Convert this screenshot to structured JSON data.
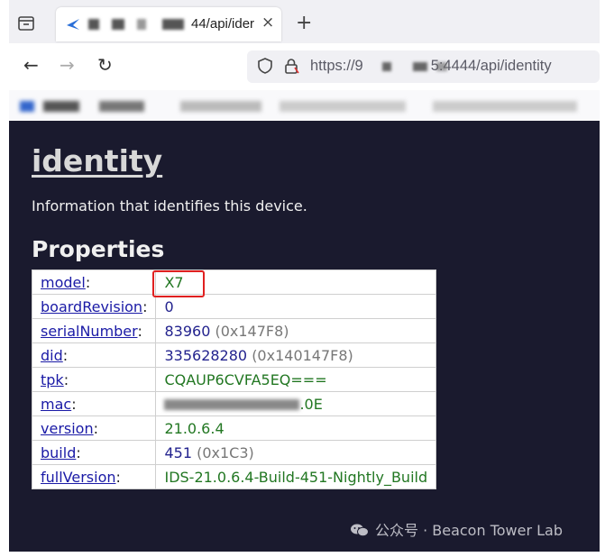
{
  "browser": {
    "tab": {
      "title_suffix": "44/api/ider",
      "close_icon": "×"
    },
    "new_tab_icon": "+",
    "nav": {
      "back_icon": "←",
      "forward_icon": "→",
      "reload_icon": "↻"
    },
    "url": {
      "prefix": "https://9",
      "suffix": "5:4444/api/identity"
    }
  },
  "page": {
    "title": "identity",
    "description": "Information that identifies this device.",
    "properties_heading": "Properties",
    "rows": [
      {
        "key": "model",
        "value": "X7",
        "extra": ""
      },
      {
        "key": "boardRevision",
        "value": "0",
        "extra": ""
      },
      {
        "key": "serialNumber",
        "value": "83960",
        "extra": "(0x147F8)"
      },
      {
        "key": "did",
        "value": "335628280",
        "extra": "(0x140147F8)"
      },
      {
        "key": "tpk",
        "value": "CQAUP6CVFA5EQ===",
        "extra": ""
      },
      {
        "key": "mac",
        "value": ".0E",
        "extra": ""
      },
      {
        "key": "version",
        "value": "21.0.6.4",
        "extra": ""
      },
      {
        "key": "build",
        "value": "451",
        "extra": "(0x1C3)"
      },
      {
        "key": "fullVersion",
        "value": "IDS-21.0.6.4-Build-451-Nightly_Build",
        "extra": ""
      }
    ],
    "colon": ":"
  },
  "watermark": {
    "text": "公众号 · Beacon Tower Lab",
    "icon": "wechat-icon"
  },
  "colors": {
    "page_background": "#1a1a2e",
    "link": "#1a1aa6",
    "string_value": "#227722",
    "number_value": "#23238e",
    "highlight_box": "#e02020"
  }
}
